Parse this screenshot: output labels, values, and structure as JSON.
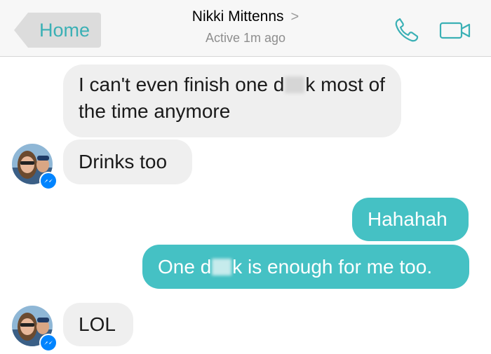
{
  "header": {
    "back_label": "Home",
    "contact_name": "Nikki Mittenns",
    "chevron": ">",
    "status": "Active 1m ago",
    "accent_color": "#3ab0b5"
  },
  "messages": [
    {
      "side": "incoming",
      "parts": [
        "I can't even finish one d",
        "k most of the time anymore"
      ],
      "censored": true
    },
    {
      "side": "incoming",
      "text": "Drinks too"
    },
    {
      "side": "outgoing",
      "text": "Hahahah"
    },
    {
      "side": "outgoing",
      "parts": [
        "One d",
        "k is enough for me too."
      ],
      "censored": true
    },
    {
      "side": "incoming",
      "text": "LOL"
    }
  ],
  "colors": {
    "incoming_bubble": "#efefef",
    "outgoing_bubble": "#45c1c4",
    "messenger_badge": "#0084ff"
  },
  "icons": [
    "phone-icon",
    "video-camera-icon",
    "messenger-badge-icon"
  ]
}
